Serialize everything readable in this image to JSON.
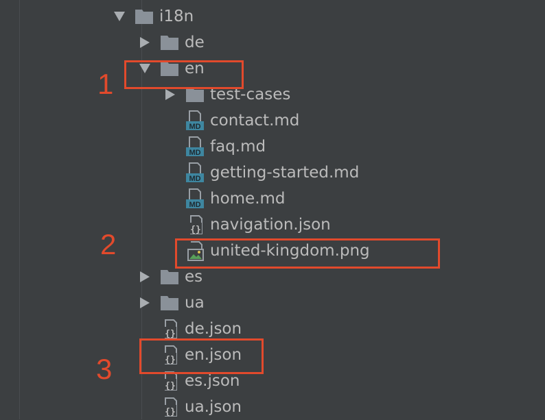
{
  "tree": {
    "root": {
      "label": "i18n",
      "icon": "folder-icon",
      "expanded": true
    },
    "items": [
      {
        "label": "de",
        "type": "folder",
        "icon": "folder-icon",
        "expanded": false
      },
      {
        "label": "en",
        "type": "folder",
        "icon": "folder-icon",
        "expanded": true
      },
      {
        "label": "test-cases",
        "type": "folder",
        "icon": "folder-icon",
        "expanded": false
      },
      {
        "label": "contact.md",
        "type": "file",
        "icon": "markdown-file-icon"
      },
      {
        "label": "faq.md",
        "type": "file",
        "icon": "markdown-file-icon"
      },
      {
        "label": "getting-started.md",
        "type": "file",
        "icon": "markdown-file-icon"
      },
      {
        "label": "home.md",
        "type": "file",
        "icon": "markdown-file-icon"
      },
      {
        "label": "navigation.json",
        "type": "file",
        "icon": "json-file-icon"
      },
      {
        "label": "united-kingdom.png",
        "type": "file",
        "icon": "image-file-icon"
      },
      {
        "label": "es",
        "type": "folder",
        "icon": "folder-icon",
        "expanded": false
      },
      {
        "label": "ua",
        "type": "folder",
        "icon": "folder-icon",
        "expanded": false
      },
      {
        "label": "de.json",
        "type": "file",
        "icon": "json-file-icon"
      },
      {
        "label": "en.json",
        "type": "file",
        "icon": "json-file-icon"
      },
      {
        "label": "es.json",
        "type": "file",
        "icon": "json-file-icon"
      },
      {
        "label": "ua.json",
        "type": "file",
        "icon": "json-file-icon"
      }
    ],
    "md_badge": "MD"
  },
  "annotations": [
    {
      "number": "1"
    },
    {
      "number": "2"
    },
    {
      "number": "3"
    }
  ],
  "colors": {
    "background": "#3c3f41",
    "text": "#bbbbbb",
    "folder": "#8a9199",
    "md_badge": "#3e86a0",
    "annotation": "#e24a2c"
  }
}
